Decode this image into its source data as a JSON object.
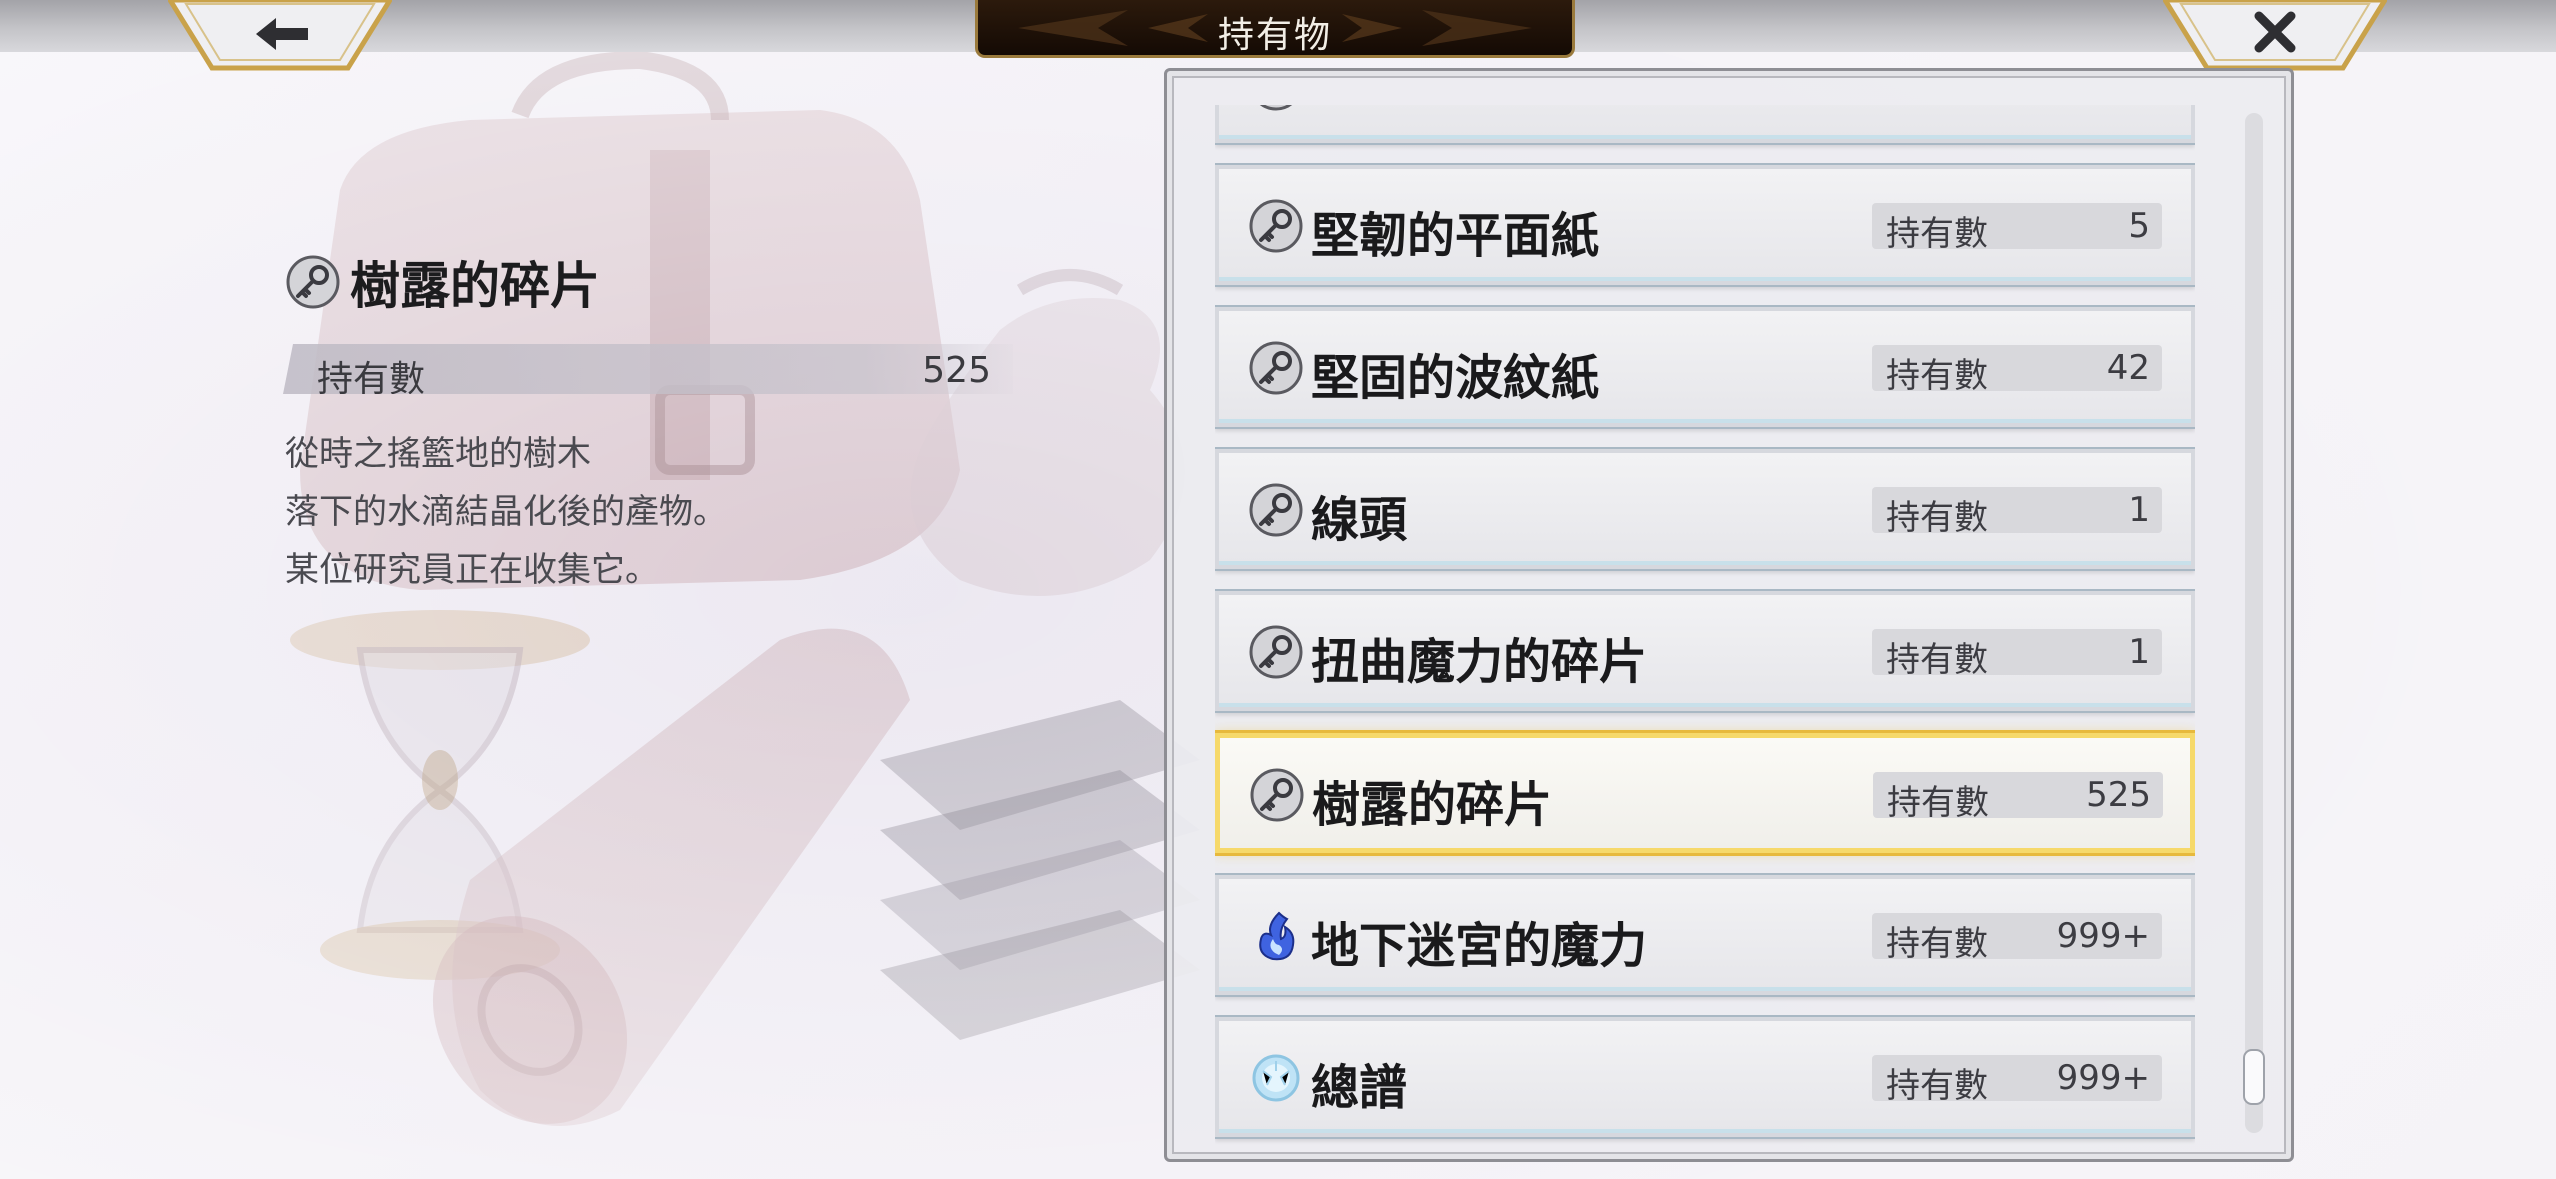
{
  "header": {
    "title": "持有物",
    "back_icon": "arrow-left-icon",
    "close_icon": "close-x-icon"
  },
  "detail": {
    "name": "樹露的碎片",
    "icon": "key-icon",
    "count_label": "持有數",
    "count_value": "525",
    "description": [
      "從時之搖籃地的樹木",
      "落下的水滴結晶化後的產物。",
      "某位研究員正在收集它。"
    ]
  },
  "list": {
    "count_label": "持有數",
    "selected_index": 5,
    "items": [
      {
        "name": "",
        "count": "",
        "icon": "key-icon"
      },
      {
        "name": "堅韌的平面紙",
        "count": "5",
        "icon": "key-icon"
      },
      {
        "name": "堅固的波紋紙",
        "count": "42",
        "icon": "key-icon"
      },
      {
        "name": "線頭",
        "count": "1",
        "icon": "key-icon"
      },
      {
        "name": "扭曲魔力的碎片",
        "count": "1",
        "icon": "key-icon"
      },
      {
        "name": "樹露的碎片",
        "count": "525",
        "icon": "key-icon"
      },
      {
        "name": "地下迷宮的魔力",
        "count": "999+",
        "icon": "blue-flame-icon"
      },
      {
        "name": "總譜",
        "count": "999+",
        "icon": "crystal-orb-icon"
      }
    ]
  },
  "scroll": {
    "position": 0.95
  },
  "colors": {
    "selected_border": "#f6d96a",
    "frame_gold": "#c9a24a",
    "title_plate": "#1c0f06"
  }
}
